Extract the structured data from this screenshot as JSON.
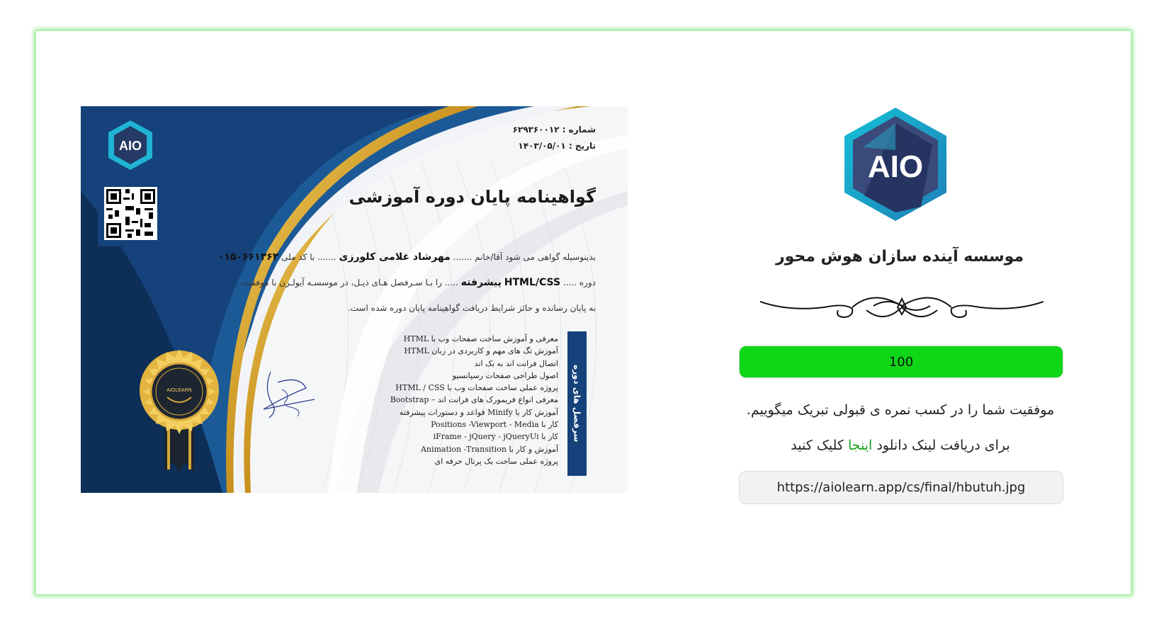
{
  "certificate": {
    "number_label": "شماره :",
    "number": "۶۲۹۳۶۰۰۱۲",
    "date_label": "تاریخ :",
    "date": "۱۴۰۳/۰۵/۰۱",
    "title": "گواهینامه پایان دوره آموزشی",
    "line1_prefix": "بدینوسیله گواهی می شود آقا/خانم",
    "recipient": "مهرشاد غلامی کلورزی",
    "national_id_label": "با کد ملی",
    "national_id": "۰۱۵۰۶۶۱۳۶۳",
    "course_label": "دوره",
    "course_name": "HTML/CSS",
    "course_level": "پیشرفته",
    "line2_suffix": "را بـا سـرفصل هـای ذیـل، در موسسـه آیولـرن  با موفقیت",
    "line3": "به پایان رسانده و حائز شرایط دریافت گواهینامه پایان دوره شده است.",
    "topics_heading": "سرفصل های دوره",
    "topics": [
      "معرفی و آموزش ساخت صفحات وب با HTML",
      "آموزش تگ های مهم و کاربردی در زبان HTML",
      "اتصال فرانت اند به بک اند",
      "اصول طراحی صفحات رسپانسیو",
      "پروژه عملی ساخت صفحات وب با HTML / CSS",
      "معرفی انواع فریمورک های فرانت اند – Bootstrap",
      "آموزش کار با Minify قواعد و دستورات پیشرفته",
      "کار با Positions -Viewport - Media",
      "کار با iFrame - jQuery - jQueryUi",
      "آموزش و کار با Animation -Transition",
      "پروژه عملی ساخت یک پرتال حرفه ای"
    ],
    "logo_text": "AIO",
    "seal_text": "AIOLEARN"
  },
  "brand": {
    "logo_text": "AIO",
    "institute_name": "موسسه آینده سازان هوش محور"
  },
  "score": {
    "value": 100,
    "label": "100",
    "fill_percent": 100,
    "color": "#0fd616"
  },
  "messages": {
    "congrats": "موفقیت شما را در کسب نمره ی قبولی تبریک میگوییم.",
    "download_prefix": "برای دریافت لینک دانلود",
    "download_link": "اینجا",
    "download_suffix": "کلیک کنید"
  },
  "certificate_url": "https://aiolearn.app/cs/final/hbutuh.jpg"
}
